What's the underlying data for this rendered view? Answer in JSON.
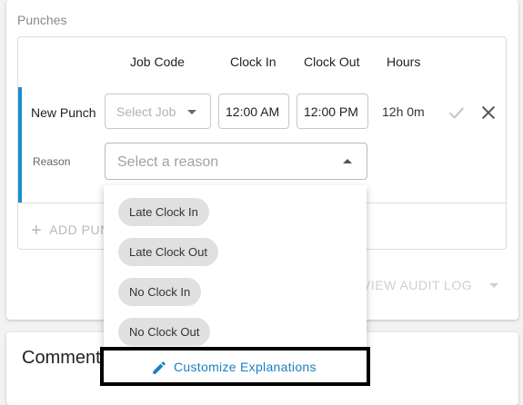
{
  "section": {
    "title": "Punches"
  },
  "table": {
    "headers": [
      "Job Code",
      "Clock In",
      "Clock Out",
      "Hours"
    ]
  },
  "row": {
    "label": "New Punch",
    "job_placeholder": "Select Job",
    "clock_in": "12:00 AM",
    "clock_out": "12:00 PM",
    "hours": "12h 0m",
    "reason_label": "Reason",
    "reason_placeholder": "Select a reason"
  },
  "add_punch": {
    "icon": "plus-icon",
    "label": "ADD PUNCH"
  },
  "audit": {
    "label": "VIEW AUDIT LOG",
    "icon": "caret-down-icon"
  },
  "comments": {
    "title": "Comments"
  },
  "dropdown": {
    "options": [
      "Late Clock In",
      "Late Clock Out",
      "No Clock In",
      "No Clock Out"
    ],
    "customize_label": "Customize Explanations",
    "customize_icon": "pencil-icon"
  },
  "colors": {
    "accent": "#1a8fd1",
    "link": "#1a7fc0",
    "chip": "#e0e0e0"
  }
}
